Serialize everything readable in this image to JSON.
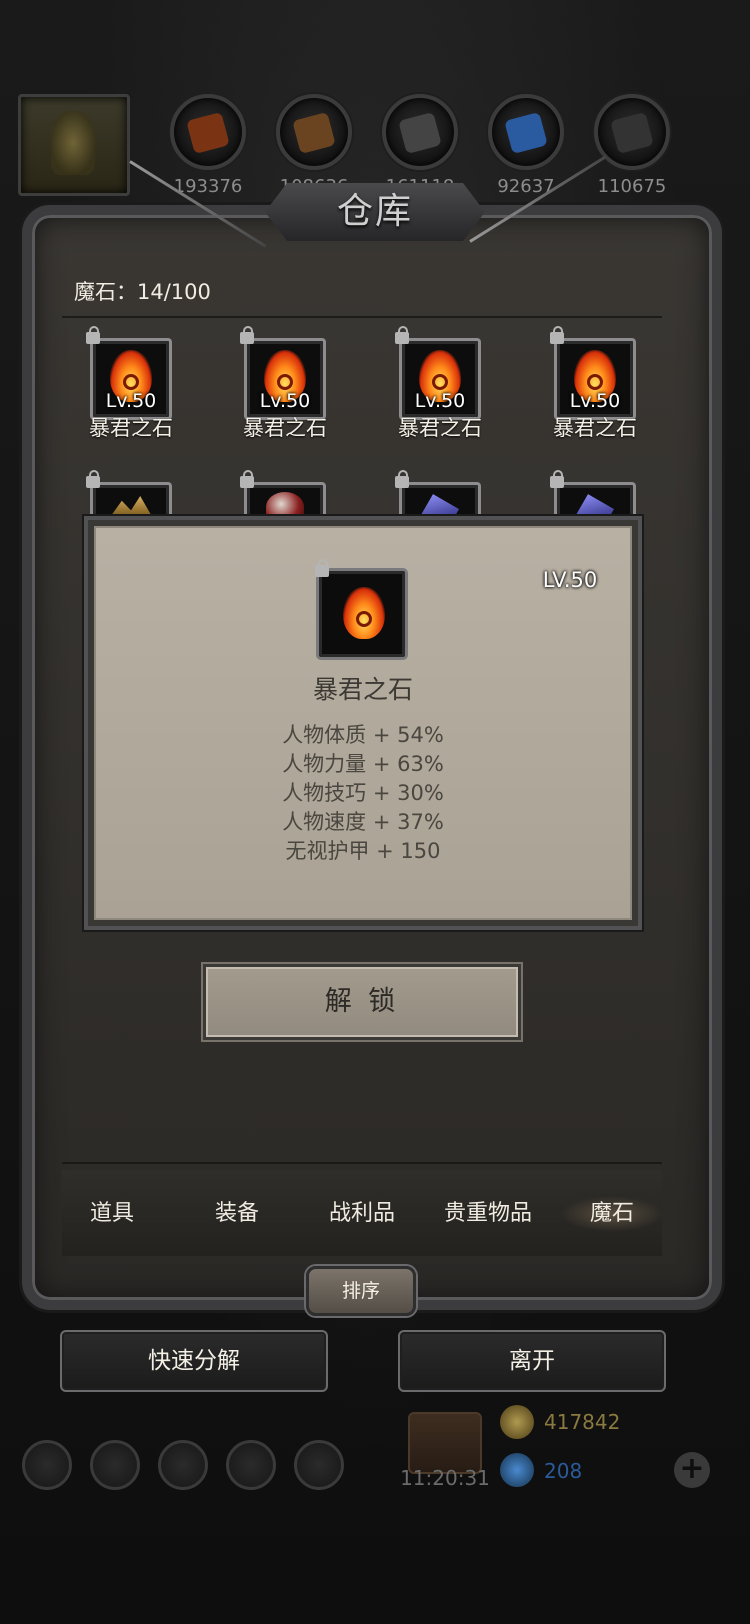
{
  "resources": {
    "counts": [
      "193376",
      "108636",
      "161118",
      "92637",
      "110675"
    ],
    "orb_colors": [
      "#8a3a1a",
      "#7a4a20",
      "#4a4a4a",
      "#2a5aa0",
      "#3a3a3a"
    ]
  },
  "warehouse": {
    "title": "仓库",
    "capacity_label": "魔石：14/100",
    "row1": [
      {
        "name": "暴君之石",
        "level": "Lv.50"
      },
      {
        "name": "暴君之石",
        "level": "Lv.50"
      },
      {
        "name": "暴君之石",
        "level": "Lv.50"
      },
      {
        "name": "暴君之石",
        "level": "Lv.50"
      }
    ]
  },
  "detail": {
    "level": "LV.50",
    "name": "暴君之石",
    "stats": [
      "人物体质 + 54%",
      "人物力量 + 63%",
      "人物技巧 + 30%",
      "人物速度 + 37%",
      "无视护甲 + 150"
    ],
    "unlock_label": "解 锁"
  },
  "tabs": [
    {
      "label": "道具",
      "active": false
    },
    {
      "label": "装备",
      "active": false
    },
    {
      "label": "战利品",
      "active": false
    },
    {
      "label": "贵重物品",
      "active": false
    },
    {
      "label": "魔石",
      "active": true
    }
  ],
  "sort_label": "排序",
  "actions": {
    "quick_disassemble": "快速分解",
    "leave": "离开"
  },
  "hud": {
    "clock": "11:20:31",
    "gold": "417842",
    "gems": "208",
    "gold_color": "#8a7a40",
    "gem_color": "#2a5a9a"
  }
}
